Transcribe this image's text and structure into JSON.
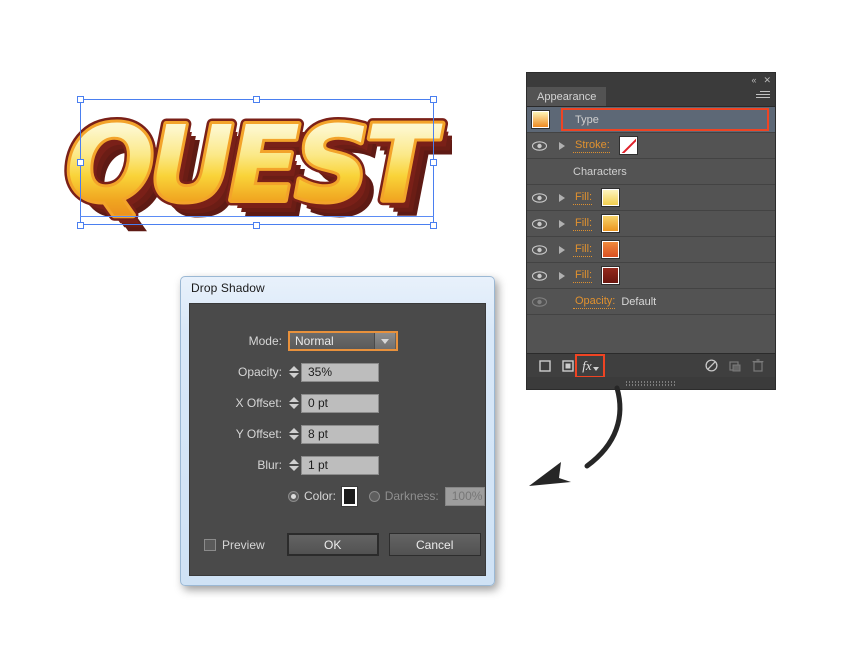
{
  "artwork": {
    "text": "QUEST",
    "selection_label": "selection-bounding-box",
    "gradient": {
      "top": "#fdfbe8",
      "upper_mid": "#fbe98a",
      "mid": "#f9d338",
      "lower": "#f0a520",
      "bottom": "#e8851c"
    },
    "outline_color": "#7a2018",
    "extrude_color": "#5e1a14",
    "selection_color": "#4a7ff0"
  },
  "dialog": {
    "title": "Drop Shadow",
    "fields": [
      {
        "label": "Mode:",
        "type": "select",
        "value": "Normal",
        "focused": true
      },
      {
        "label": "Opacity:",
        "type": "stepper",
        "value": "35%"
      },
      {
        "label": "X Offset:",
        "type": "stepper",
        "value": "0 pt"
      },
      {
        "label": "Y Offset:",
        "type": "stepper",
        "value": "8 pt"
      },
      {
        "label": "Blur:",
        "type": "stepper",
        "value": "1 pt"
      }
    ],
    "color_option": {
      "label": "Color:",
      "selected": true,
      "swatch": "#1b1b1b"
    },
    "darkness_option": {
      "label": "Darkness:",
      "selected": false,
      "value": "100%",
      "disabled": true
    },
    "preview": {
      "label": "Preview",
      "checked": false
    },
    "ok_label": "OK",
    "cancel_label": "Cancel",
    "accent_focus_color": "#e8913c"
  },
  "appearance_panel": {
    "tab_label": "Appearance",
    "rows": [
      {
        "id": "type",
        "label": "Type",
        "kind": "header",
        "selected": true,
        "highlighted": true,
        "thumb": "gradient-gold"
      },
      {
        "id": "stroke",
        "label": "Stroke:",
        "kind": "link",
        "eye": true,
        "disclosure": true,
        "swatch": "none"
      },
      {
        "id": "characters",
        "label": "Characters",
        "kind": "plain",
        "eye": false,
        "disclosure": false
      },
      {
        "id": "fill-1",
        "label": "Fill:",
        "kind": "link",
        "eye": true,
        "disclosure": true,
        "swatch": "#f7e27a"
      },
      {
        "id": "fill-2",
        "label": "Fill:",
        "kind": "link",
        "eye": true,
        "disclosure": true,
        "swatch": "#f0a32a"
      },
      {
        "id": "fill-3",
        "label": "Fill:",
        "kind": "link",
        "eye": true,
        "disclosure": true,
        "swatch": "#e2602a"
      },
      {
        "id": "opacity",
        "label": "Opacity:",
        "kind": "link",
        "eye": true,
        "eye_dim": true,
        "disclosure": false,
        "value": "Default"
      }
    ],
    "fill_4": {
      "label": "Fill:",
      "swatch": "#7d1f16"
    },
    "footer_icons": [
      {
        "name": "add-new-stroke-icon",
        "enabled": true
      },
      {
        "name": "add-new-fill-icon",
        "enabled": true
      },
      {
        "name": "fx-icon",
        "enabled": true,
        "label": "fx",
        "highlighted": true
      },
      {
        "name": "clear-appearance-icon",
        "enabled": true
      },
      {
        "name": "duplicate-item-icon",
        "enabled": false
      },
      {
        "name": "delete-item-icon",
        "enabled": false
      }
    ],
    "collapse_icon": "«",
    "close_icon": "✕",
    "highlight_color": "#ef4423",
    "link_color": "#e0912f"
  },
  "annotation": {
    "arrow": "curved-arrow-pointing-down-left"
  }
}
